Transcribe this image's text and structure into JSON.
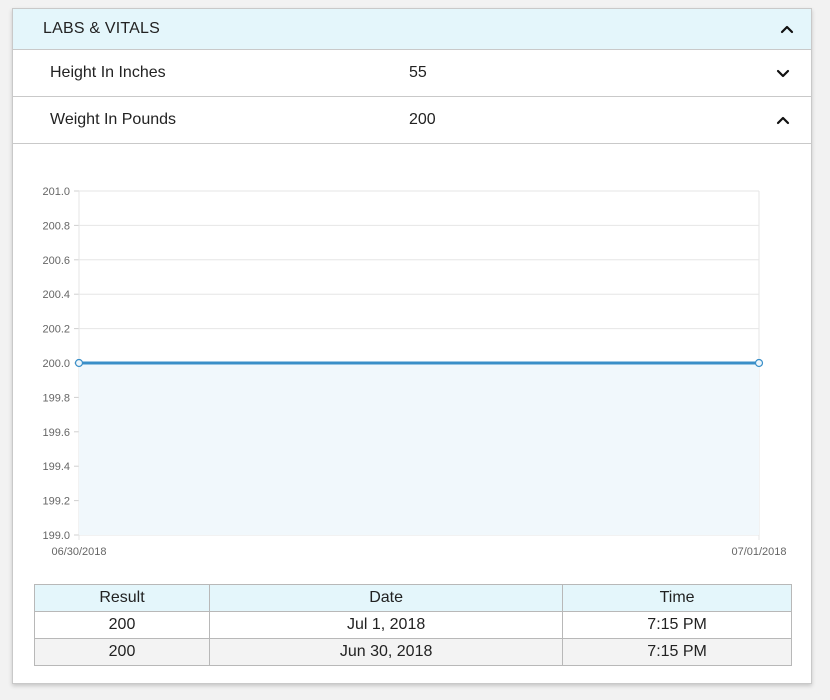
{
  "panel": {
    "title": "LABS & VITALS",
    "rows": [
      {
        "label": "Height In Inches",
        "value": "55",
        "state": "collapsed",
        "icon": "chevron-down-icon"
      },
      {
        "label": "Weight In Pounds",
        "value": "200",
        "state": "expanded",
        "icon": "chevron-up-icon"
      }
    ]
  },
  "chart_data": {
    "type": "line",
    "x": [
      "06/30/2018",
      "07/01/2018"
    ],
    "series": [
      {
        "values": [
          200.0,
          200.0
        ],
        "color": "#3a8fc8",
        "fill": "#f1f8fc"
      }
    ],
    "yticks": [
      "201.0",
      "200.8",
      "200.6",
      "200.4",
      "200.2",
      "200.0",
      "199.8",
      "199.6",
      "199.4",
      "199.2",
      "199.0"
    ],
    "ylim": [
      199.0,
      201.0
    ],
    "grid": true,
    "title": "",
    "xlabel": "",
    "ylabel": ""
  },
  "table": {
    "headers": [
      "Result",
      "Date",
      "Time"
    ],
    "rows": [
      [
        "200",
        "Jul 1, 2018",
        "7:15 PM"
      ],
      [
        "200",
        "Jun 30, 2018",
        "7:15 PM"
      ]
    ]
  },
  "colors": {
    "header_bg": "#e4f6fb",
    "line": "#3a8fc8",
    "border": "#c9c9c9"
  }
}
